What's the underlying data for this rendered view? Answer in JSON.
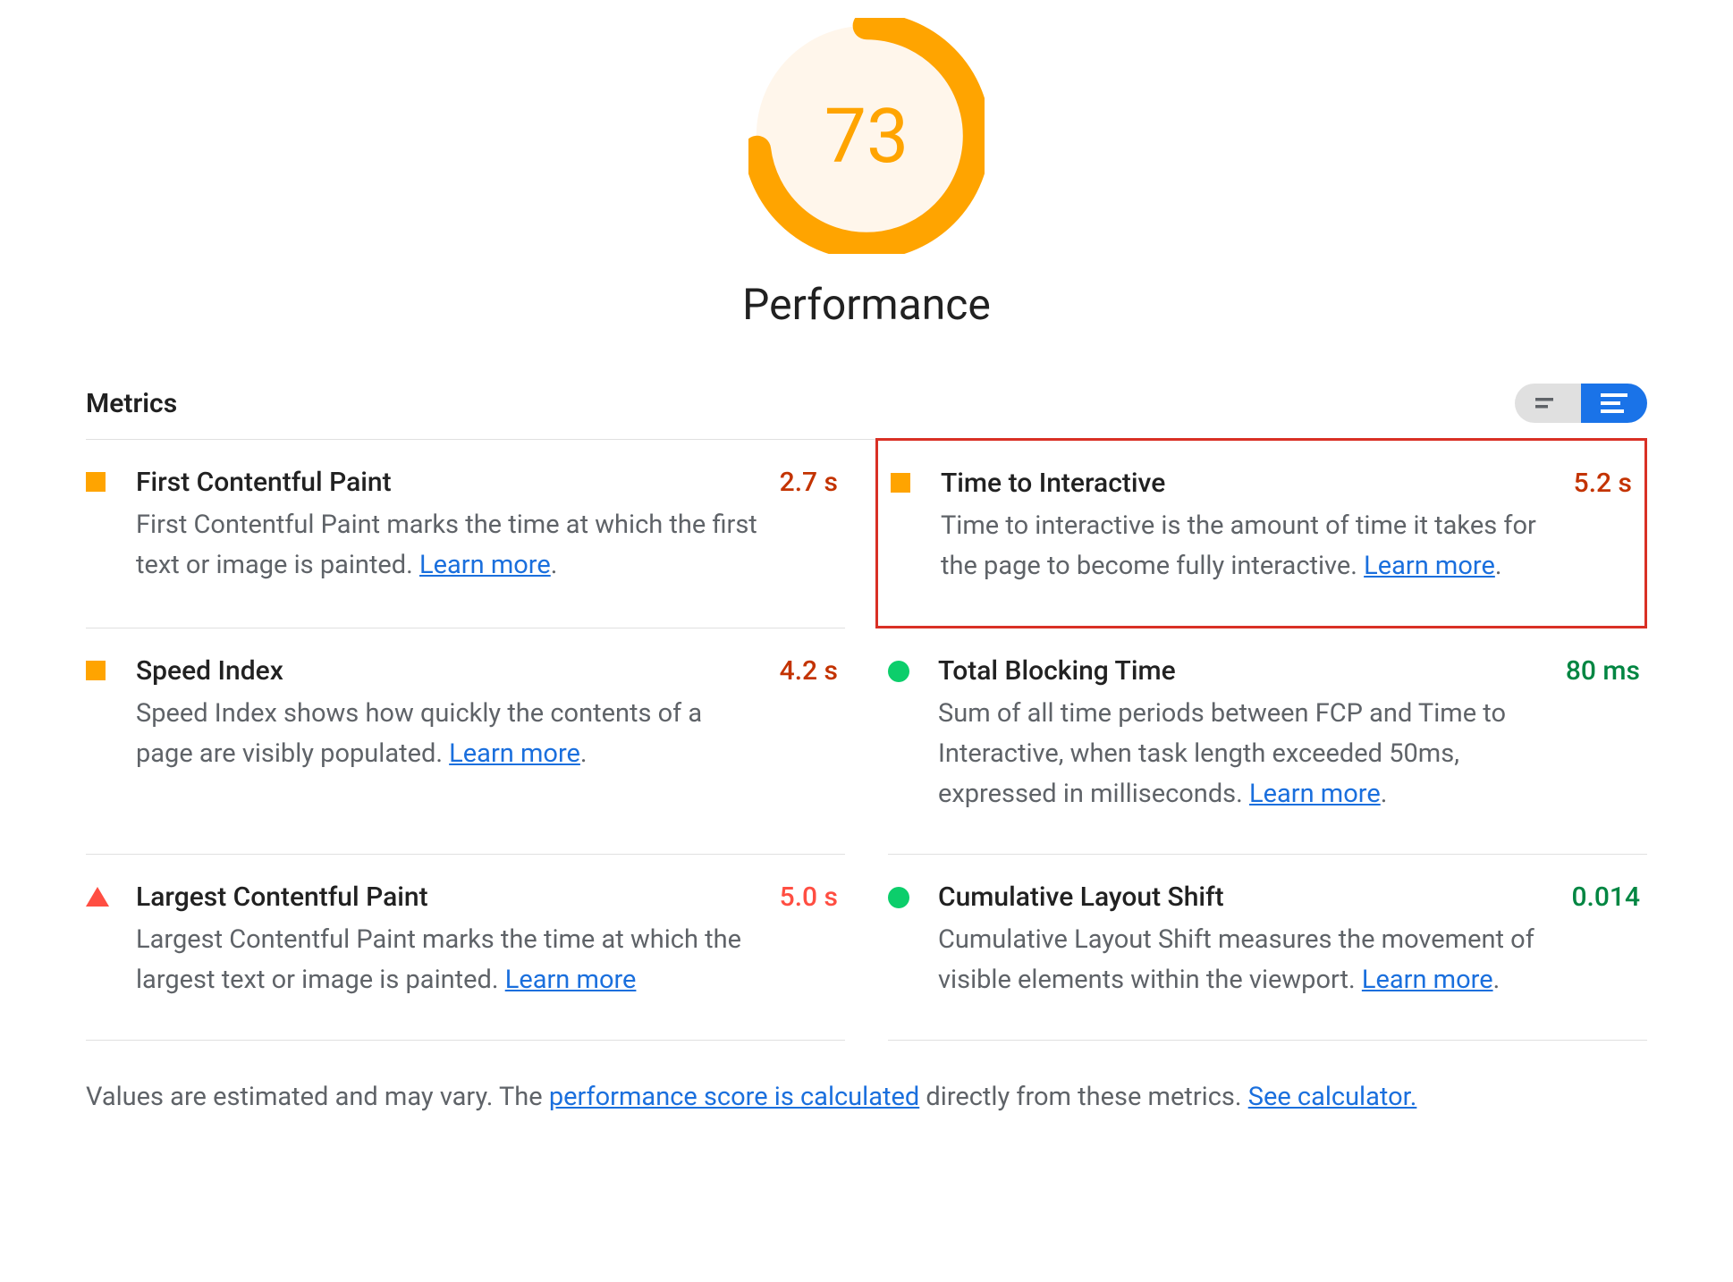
{
  "gauge": {
    "score": "73",
    "score_num": 73,
    "label": "Performance"
  },
  "header": {
    "title": "Metrics"
  },
  "metrics": [
    {
      "id": "fcp",
      "status": "average",
      "title": "First Contentful Paint",
      "desc_prefix": "First Contentful Paint marks the time at which the first text or image is painted. ",
      "learn_more": "Learn more",
      "desc_suffix": ".",
      "value": "2.7 s",
      "value_class": "val-avg",
      "highlighted": false
    },
    {
      "id": "tti",
      "status": "average",
      "title": "Time to Interactive",
      "desc_prefix": "Time to interactive is the amount of time it takes for the page to become fully interactive. ",
      "learn_more": "Learn more",
      "desc_suffix": ".",
      "value": "5.2 s",
      "value_class": "val-avg",
      "highlighted": true
    },
    {
      "id": "si",
      "status": "average",
      "title": "Speed Index",
      "desc_prefix": "Speed Index shows how quickly the contents of a page are visibly populated. ",
      "learn_more": "Learn more",
      "desc_suffix": ".",
      "value": "4.2 s",
      "value_class": "val-avg",
      "highlighted": false
    },
    {
      "id": "tbt",
      "status": "pass",
      "title": "Total Blocking Time",
      "desc_prefix": "Sum of all time periods between FCP and Time to Interactive, when task length exceeded 50ms, expressed in milliseconds. ",
      "learn_more": "Learn more",
      "desc_suffix": ".",
      "value": "80 ms",
      "value_class": "val-pass",
      "highlighted": false
    },
    {
      "id": "lcp",
      "status": "fail",
      "title": "Largest Contentful Paint",
      "desc_prefix": "Largest Contentful Paint marks the time at which the largest text or image is painted. ",
      "learn_more": "Learn more",
      "desc_suffix": "",
      "value": "5.0 s",
      "value_class": "val-fail",
      "highlighted": false
    },
    {
      "id": "cls",
      "status": "pass",
      "title": "Cumulative Layout Shift",
      "desc_prefix": "Cumulative Layout Shift measures the movement of visible elements within the viewport. ",
      "learn_more": "Learn more",
      "desc_suffix": ".",
      "value": "0.014",
      "value_class": "val-pass",
      "highlighted": false
    }
  ],
  "footnote": {
    "prefix": "Values are estimated and may vary. The ",
    "link1": "performance score is calculated",
    "middle": " directly from these metrics. ",
    "link2": "See calculator."
  }
}
